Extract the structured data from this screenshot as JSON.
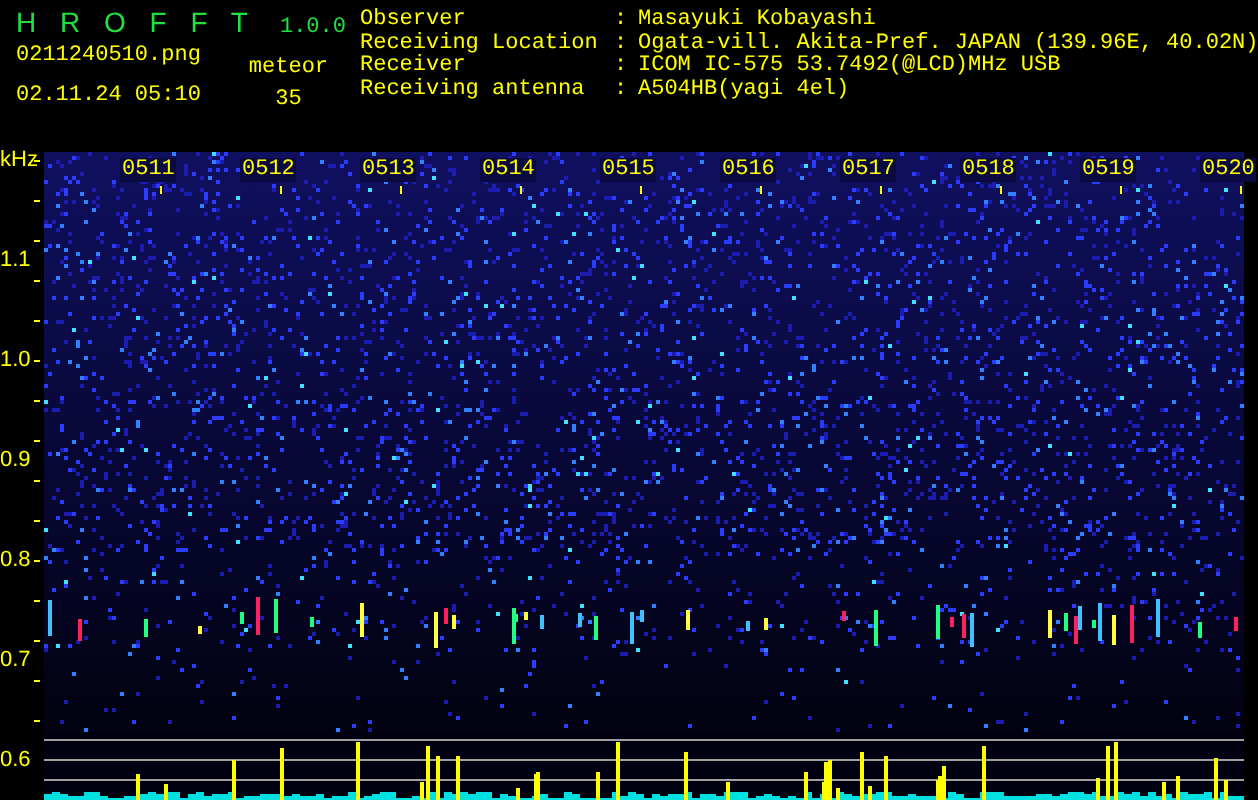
{
  "app": {
    "name": "H R O F F T",
    "version": "1.0.0"
  },
  "file": {
    "filename": "0211240510.png",
    "datetime": "02.11.24 05:10",
    "count_label": "meteor",
    "count": "35"
  },
  "info": [
    {
      "label": "Observer",
      "separator": ":",
      "value": "Masayuki Kobayashi"
    },
    {
      "label": "Receiving Location",
      "separator": ":",
      "value": "Ogata-vill. Akita-Pref. JAPAN (139.96E, 40.02N)"
    },
    {
      "label": "Receiver",
      "separator": ":",
      "value": "ICOM IC-575 53.7492(@LCD)MHz USB"
    },
    {
      "label": "Receiving antenna",
      "separator": ":",
      "value": "A504HB(yagi 4el)"
    }
  ],
  "chart": {
    "unit": "kHz",
    "frequency_labels": [
      "1.1",
      "1.0",
      "0.9",
      "0.8",
      "0.7",
      "0.6"
    ],
    "time_labels": [
      "0511",
      "0512",
      "0513",
      "0514",
      "0515",
      "0516",
      "0517",
      "0518",
      "0519",
      "0520"
    ]
  }
}
